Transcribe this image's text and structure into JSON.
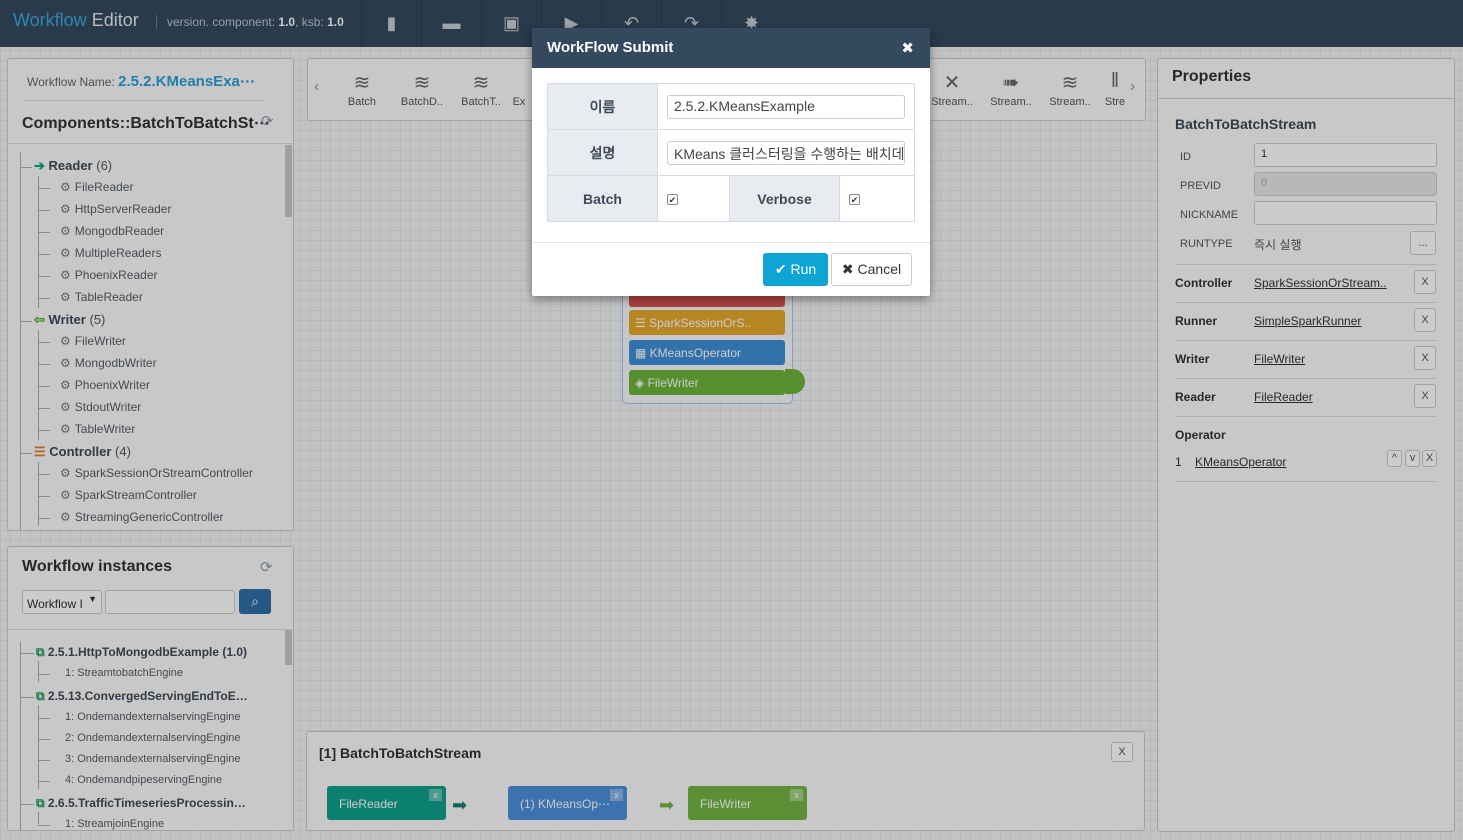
{
  "header": {
    "title_part1": "Workflow",
    "title_part2": "Editor",
    "version_label": "version. component:",
    "component_version": "1.0",
    "ksb_label": ", ksb:",
    "ksb_version": "1.0",
    "buttons": [
      {
        "icon": "new-file-icon",
        "glyph": "▮"
      },
      {
        "icon": "folder-icon",
        "glyph": "▬"
      },
      {
        "icon": "save-icon",
        "glyph": "▣"
      },
      {
        "icon": "play-icon",
        "glyph": "▶"
      },
      {
        "icon": "undo-icon",
        "glyph": "↶"
      },
      {
        "icon": "redo-icon",
        "glyph": "↷"
      },
      {
        "icon": "debug-icon",
        "glyph": "✸"
      }
    ]
  },
  "components_panel": {
    "workflow_name_label": "Workflow Name:",
    "workflow_name": "2.5.2.KMeansExa⋯",
    "title": "Components::BatchToBatchSt⋯",
    "groups": [
      {
        "label": "Reader",
        "count": "(6)",
        "color": "#16a085",
        "items": [
          "FileReader",
          "HttpServerReader",
          "MongodbReader",
          "MultipleReaders",
          "PhoenixReader",
          "TableReader"
        ]
      },
      {
        "label": "Writer",
        "count": "(5)",
        "color": "#4cae1c",
        "items": [
          "FileWriter",
          "MongodbWriter",
          "PhoenixWriter",
          "StdoutWriter",
          "TableWriter"
        ]
      },
      {
        "label": "Controller",
        "count": "(4)",
        "color": "#e67e22",
        "items": [
          "SparkSessionOrStreamController",
          "SparkStreamController",
          "StreamingGenericController"
        ]
      }
    ]
  },
  "toolbar": {
    "items": [
      "Batch",
      "BatchD..",
      "BatchT..",
      "Ex",
      "Stream..",
      "Stream..",
      "Stream..",
      "Stre"
    ]
  },
  "instances_panel": {
    "title": "Workflow instances",
    "select_value": "Workflow I",
    "search_placeholder": "",
    "instances": [
      {
        "name": "2.5.1.HttpToMongodbExample (1.0)",
        "engines": [
          "1: StreamtobatchEngine"
        ]
      },
      {
        "name": "2.5.13.ConvergedServingEndToE…",
        "engines": [
          "1: OndemandexternalservingEngine",
          "2: OndemandexternalservingEngine",
          "3: OndemandexternalservingEngine",
          "4: OndemandpipeservingEngine"
        ]
      },
      {
        "name": "2.6.5.TrafficTimeseriesProcessin…",
        "engines": [
          "1: StreamjoinEngine"
        ]
      }
    ]
  },
  "canvas": {
    "nodes": [
      {
        "label": "",
        "color": "#d9534f"
      },
      {
        "label": "SparkSessionOrS..",
        "color": "#e5a92e"
      },
      {
        "label": "KMeansOperator",
        "color": "#3e8ed8"
      },
      {
        "label": "FileWriter",
        "color": "#6fb33a"
      }
    ]
  },
  "engine_panel": {
    "title": "[1] BatchToBatchStream",
    "close": "X",
    "chips": [
      {
        "label": "FileReader",
        "color": "#10a08a"
      },
      {
        "label": "(1) KMeansOp⋯",
        "color": "#4a8fdb"
      },
      {
        "label": "FileWriter",
        "color": "#74b544"
      }
    ],
    "chip_close": "x"
  },
  "properties": {
    "title": "Properties",
    "section": "BatchToBatchStream",
    "id_label": "ID",
    "id_value": "1",
    "previd_label": "PREVID",
    "previd_value": "0",
    "nickname_label": "NICKNAME",
    "nickname_value": "",
    "runtype_label": "RUNTYPE",
    "runtype_value": "즉시 실행",
    "more_button": "...",
    "controller_label": "Controller",
    "controller_value": "SparkSessionOrStream..",
    "runner_label": "Runner",
    "runner_value": "SimpleSparkRunner",
    "writer_label": "Writer",
    "writer_value": "FileWriter",
    "reader_label": "Reader",
    "reader_value": "FileReader",
    "remove": "X",
    "operator_label": "Operator",
    "operator_index": "1",
    "operator_value": "KMeansOperator",
    "up": "^",
    "down": "v"
  },
  "modal": {
    "title": "WorkFlow Submit",
    "close": "✖",
    "name_label": "이름",
    "name_value": "2.5.2.KMeansExample",
    "desc_label": "설명",
    "desc_value": "KMeans 클러스터링을 수행하는 배치데이터",
    "batch_label": "Batch",
    "batch_checked": true,
    "verbose_label": "Verbose",
    "verbose_checked": true,
    "check_glyph": "✔",
    "run_label": "Run",
    "cancel_label": "Cancel"
  }
}
